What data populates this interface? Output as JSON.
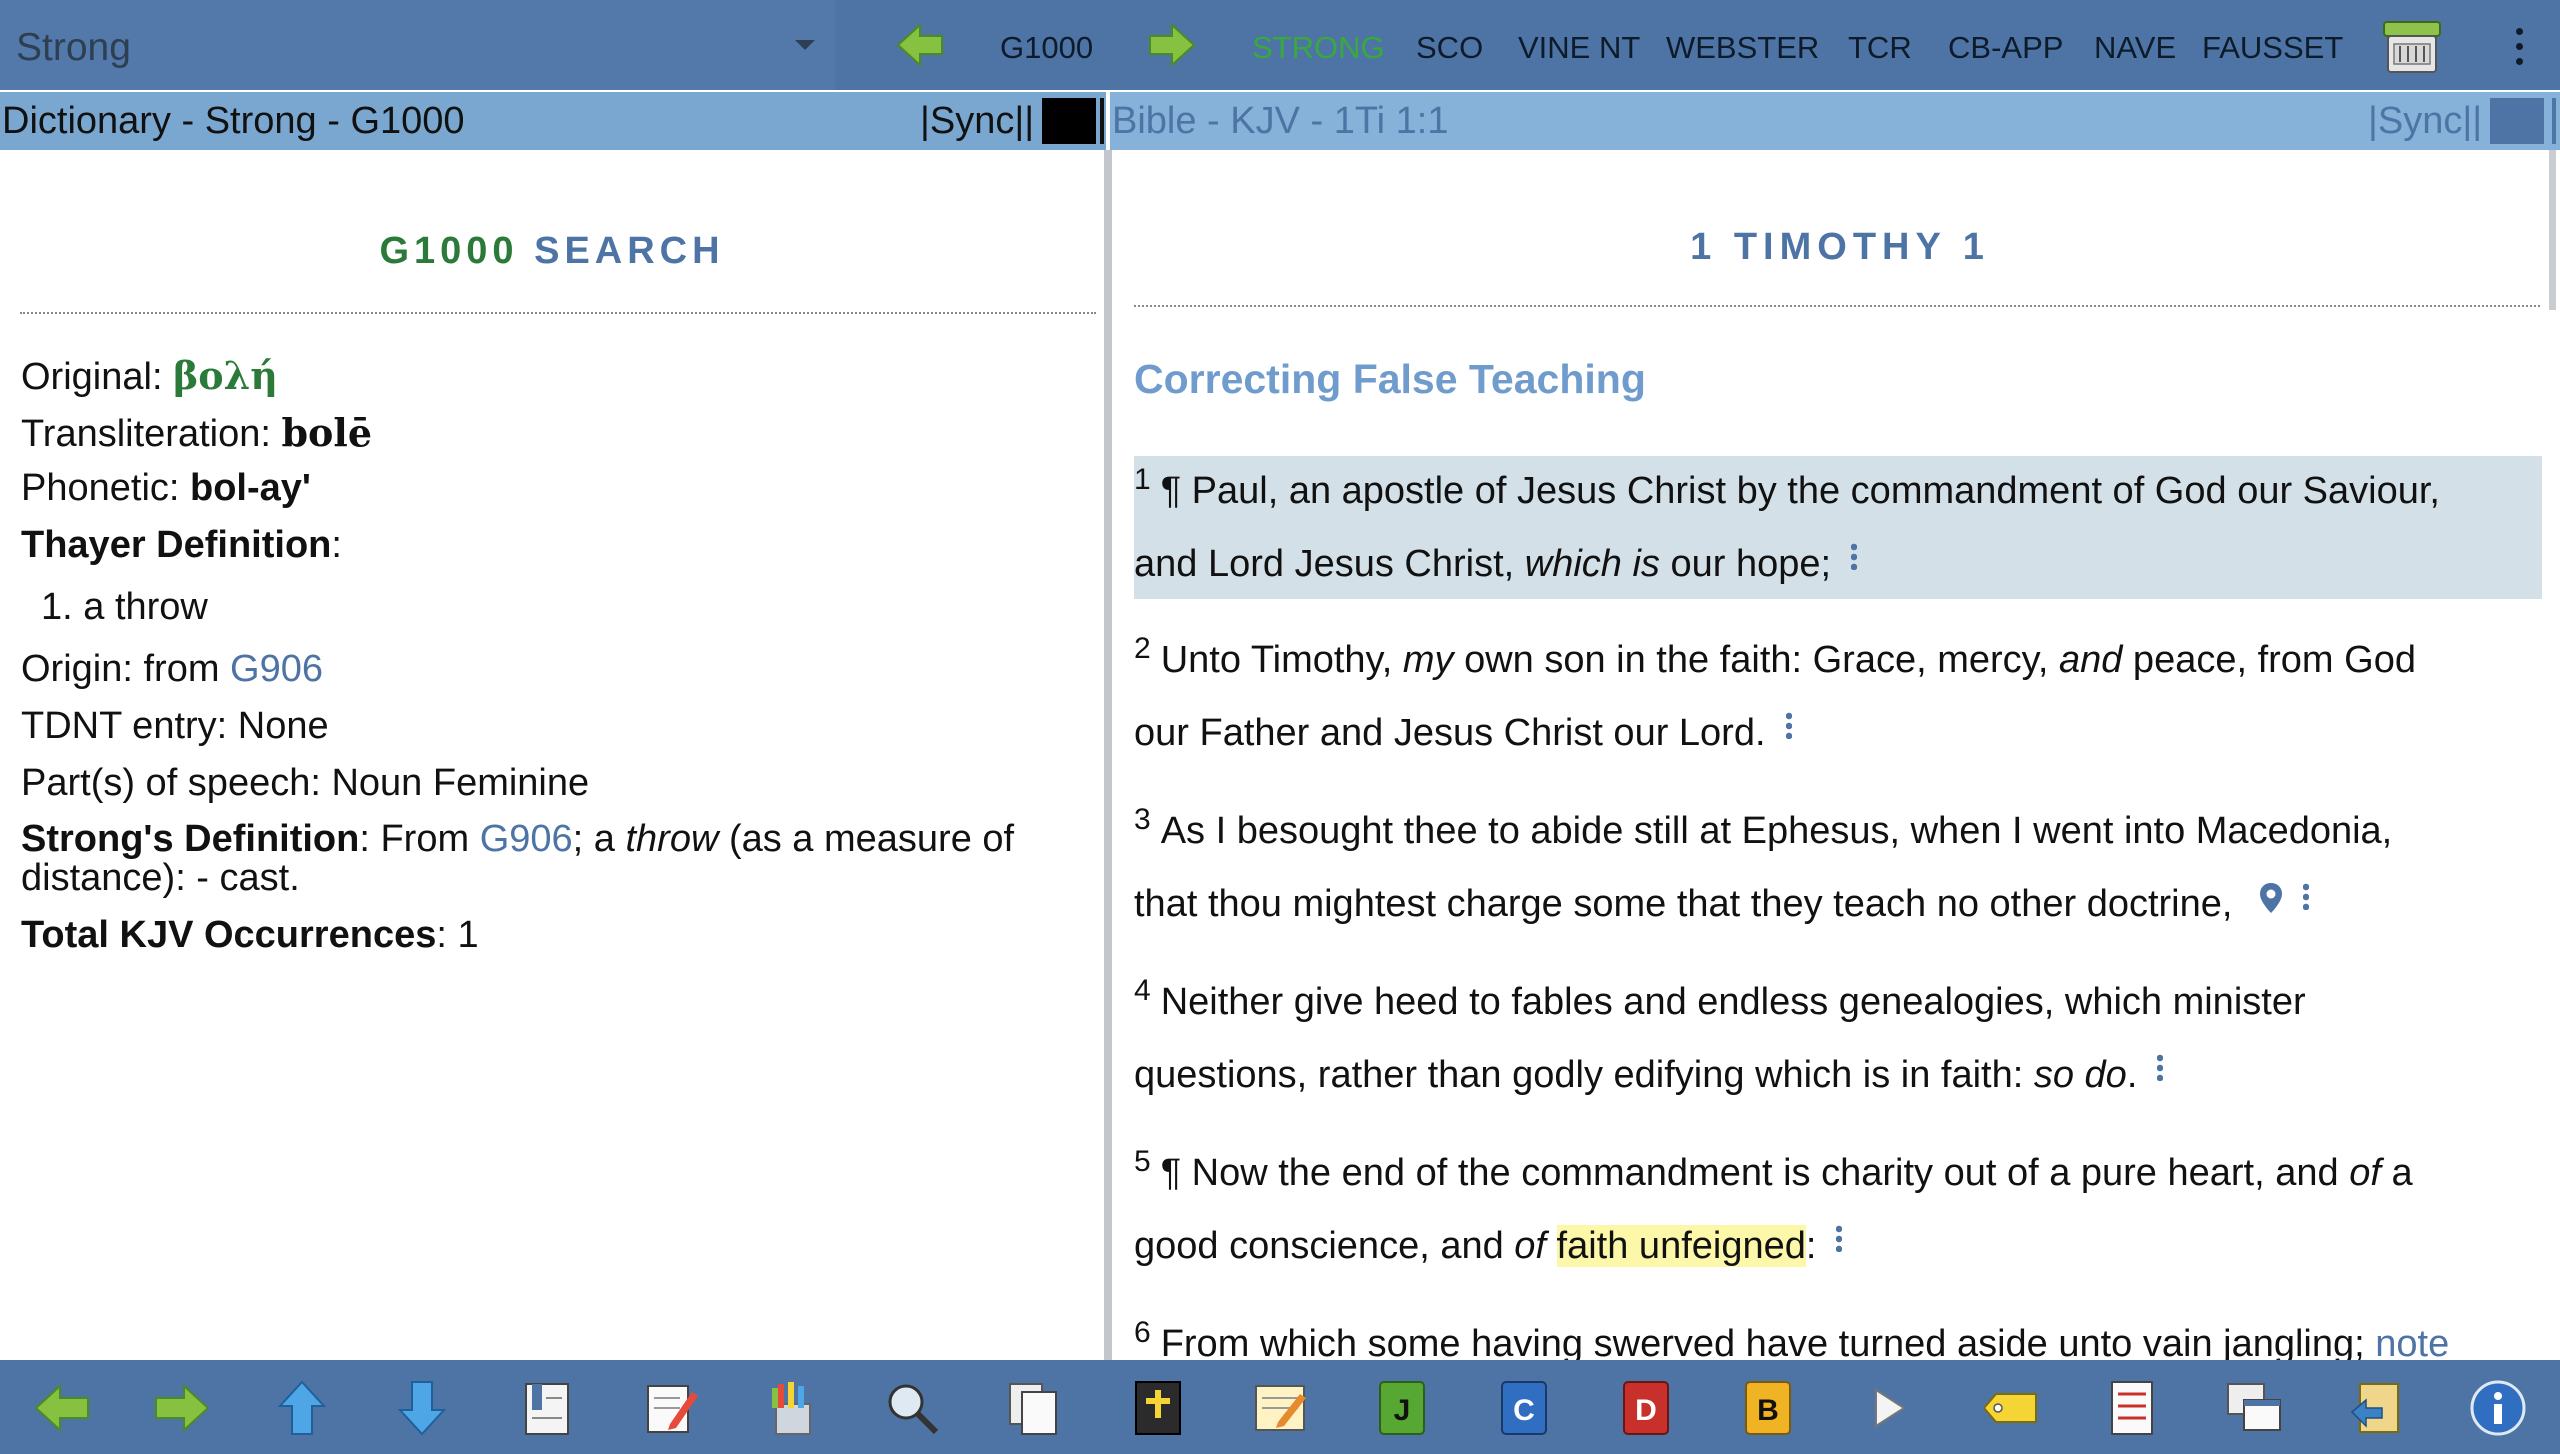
{
  "topbar": {
    "module_name": "Strong",
    "current_key": "G1000",
    "tabs": [
      "STRONG",
      "SCO",
      "VINE NT",
      "WEBSTER",
      "TCR",
      "CB-APP",
      "NAVE",
      "FAUSSET"
    ],
    "active_tab": "STRONG",
    "icons": [
      "back-arrow-icon",
      "forward-arrow-icon",
      "store-icon",
      "overflow-menu-icon"
    ]
  },
  "left_header": {
    "title": "Dictionary - Strong - G1000",
    "sync": "|Sync||",
    "swatch_color": "#000000"
  },
  "right_header": {
    "title": "Bible - KJV - 1Ti 1:1",
    "sync": "|Sync||",
    "swatch_color": "#4e74a5"
  },
  "dictionary": {
    "heading_code": "G1000",
    "heading_action": "SEARCH",
    "original_label": "Original: ",
    "original_value": "βολή",
    "translit_label": "Transliteration: ",
    "translit_value": "bolē",
    "phonetic_label": "Phonetic: ",
    "phonetic_value": "bol-ay'",
    "thayer_label": "Thayer Definition",
    "thayer_colon": ":",
    "thayer_item": "1. a throw",
    "origin_label": "Origin: from ",
    "origin_link": "G906",
    "tdnt": "TDNT entry: None",
    "pos": "Part(s) of speech: Noun Feminine",
    "strongs_label": "Strong's Definition",
    "strongs_pre": ": From ",
    "strongs_link": "G906",
    "strongs_mid": "; a ",
    "strongs_italic": "throw",
    "strongs_post": " (as a measure of",
    "strongs_line2": "distance): - cast.",
    "total_label": "Total KJV Occurrences",
    "total_value": ": 1"
  },
  "bible": {
    "book_heading": "1 TIMOTHY 1",
    "section_title": "Correcting False Teaching",
    "v1": {
      "num": "1",
      "a": "¶ Paul, an apostle of Jesus Christ by the commandment of God our Saviour,",
      "b": "and Lord Jesus Christ, ",
      "i": "which is",
      "c": " our hope;"
    },
    "v2": {
      "num": "2",
      "a": "Unto Timothy, ",
      "i1": "my",
      "b": " own son in the faith: Grace, mercy, ",
      "i2": "and",
      "c": " peace, from God",
      "d": "our Father and Jesus Christ our Lord."
    },
    "v3": {
      "num": "3",
      "a": "As I besought thee to abide still at Ephesus, when I went into Macedonia,",
      "b": "that thou mightest charge some that they teach no other doctrine,"
    },
    "v4": {
      "num": "4",
      "a": "Neither give heed to fables and endless genealogies, which minister",
      "b": "questions, rather than godly edifying which is in faith: ",
      "i": "so do",
      "c": "."
    },
    "v5": {
      "num": "5",
      "a": "¶ Now the end of the commandment is charity out of a pure heart, and ",
      "i1": "of",
      "b": " a",
      "c": "good conscience, and ",
      "i2": "of",
      "hl": "faith unfeigned",
      "d": ":"
    },
    "v6": {
      "num": "6",
      "a": "From which some having swerved have turned aside unto vain jangling; ",
      "note": "note"
    }
  },
  "bottombar": {
    "icons": [
      "back-icon",
      "forward-icon",
      "up-icon",
      "down-icon",
      "bookmark-icon",
      "edit-note-icon",
      "highlight-colors-icon",
      "search-icon",
      "copy-icon",
      "bible-icon",
      "notes-icon",
      "journal-icon",
      "commentary-icon",
      "dictionary-icon",
      "book-icon",
      "play-icon",
      "tag-icon",
      "document-icon",
      "windows-icon",
      "back-history-icon",
      "info-icon"
    ]
  }
}
